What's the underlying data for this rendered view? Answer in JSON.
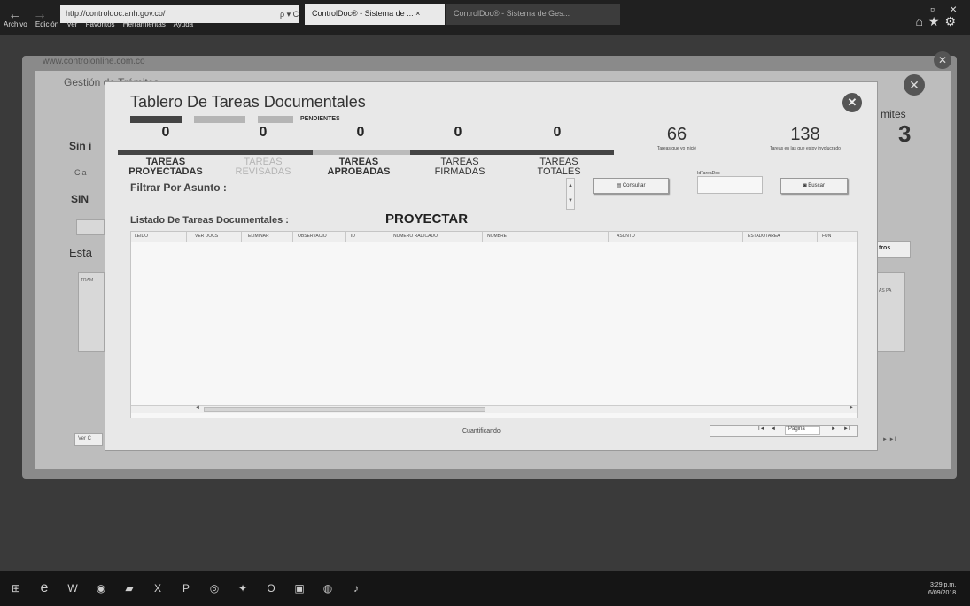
{
  "browser": {
    "address": "http://controldoc.anh.gov.co/",
    "address_tools": "ρ ▾ C",
    "tabs": [
      {
        "label": "ControlDoc® - Sistema de ... ×"
      },
      {
        "label": "ControlDoc® - Sistema de Ges..."
      }
    ],
    "menu": [
      "Archivo",
      "Edición",
      "Ver",
      "Favoritos",
      "Herramientas",
      "Ayuda"
    ]
  },
  "background": {
    "url": "www.controlonline.com.co",
    "title": "Gestión de Trámites",
    "right_fragment": "mites",
    "right_number": "3",
    "frag_sin": "Sin i",
    "frag_cla": "Cla",
    "frag_sin2": "SIN",
    "frag_esta": "Esta",
    "frag_tram": "TRAM",
    "frag_ver": "Ver C",
    "frag_tros": "tros",
    "frag_pag": "AS PA",
    "frag_pager": "► ►I"
  },
  "modal": {
    "title": "Tablero De Tareas Documentales",
    "pending_label": "PENDIENTES",
    "categories": [
      {
        "count": "0",
        "line1": "TAREAS",
        "line2": "PROYECTADAS"
      },
      {
        "count": "0",
        "line1": "TAREAS",
        "line2": "REVISADAS"
      },
      {
        "count": "0",
        "line1": "TAREAS",
        "line2": "APROBADAS"
      },
      {
        "count": "0",
        "line1": "TAREAS",
        "line2": "FIRMADAS"
      },
      {
        "count": "0",
        "line1": "TAREAS",
        "line2": "TOTALES"
      }
    ],
    "started_count": "66",
    "started_caption": "Tareas que yo inicié",
    "involved_count": "138",
    "involved_caption": "Tareas en las que estoy involucrado",
    "filter_label": "Filtrar Por Asunto :",
    "consult_button": "Consultar",
    "field_label": "IdTareaDoc",
    "search_button": "Buscar",
    "list_label": "Listado De Tareas Documentales :",
    "list_mode": "PROYECTAR",
    "columns": [
      "LEIDO",
      "VER DOCS",
      "ELIMINAR",
      "OBSERVACIO",
      "ID",
      "NUMERO RADICADO",
      "NOMBRE",
      "ASUNTO",
      "ESTADOTAREA",
      "FUN"
    ],
    "status": "Cuantificando",
    "pager_page": "Página",
    "pager_first": "I◄",
    "pager_prev": "◄",
    "pager_next": "►",
    "pager_last": "►I"
  },
  "taskbar": {
    "time": "3:29 p.m.",
    "date": "6/09/2018"
  }
}
